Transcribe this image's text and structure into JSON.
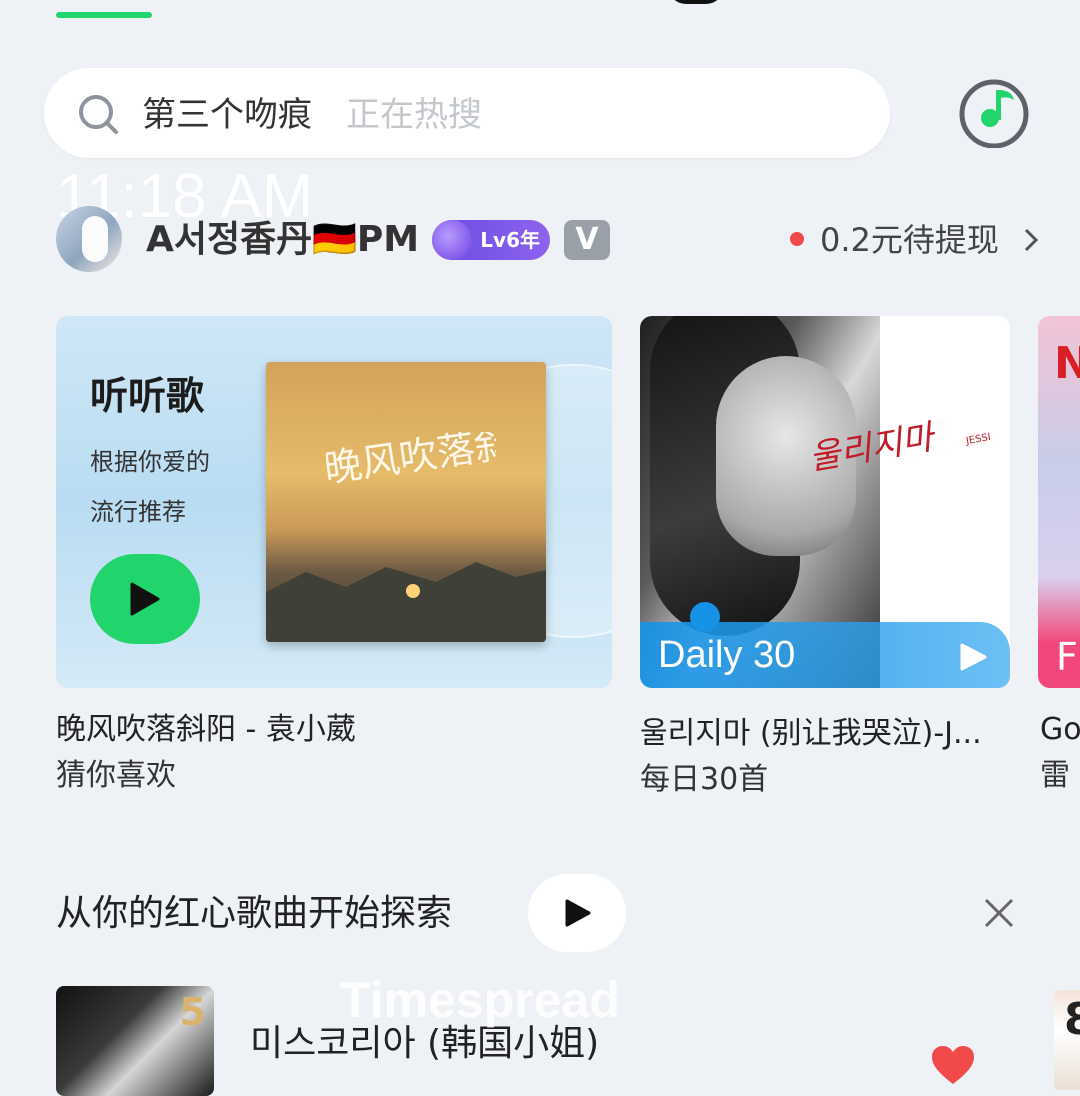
{
  "status": {
    "time": "11:18 AM"
  },
  "search": {
    "term": "第三个吻痕",
    "hint": "正在热搜"
  },
  "profile": {
    "username": "A서정香丹🇩🇪PM",
    "level_badge": "Lv6年",
    "v_badge": "V",
    "cashout": "0.2元待提现"
  },
  "cards": [
    {
      "title": "听听歌",
      "subtitle_line1": "根据你爱的",
      "subtitle_line2": "流行推荐",
      "album_art_text": "晚风吹落斜阳",
      "caption_title": "晚风吹落斜阳 - 袁小葳",
      "caption_sub": "猜你喜欢"
    },
    {
      "overlay_label": "Daily 30",
      "album_script": "울리지마",
      "album_script_small": "JESSI",
      "caption_title": "울리지마 (别让我哭泣)-J...",
      "caption_sub": "每日30首"
    },
    {
      "logo_letter": "N",
      "overlay_letter": "F",
      "caption_title": "Go",
      "caption_sub": "雷"
    }
  ],
  "section": {
    "title": "从你的红心歌曲开始探索"
  },
  "song": {
    "title": "미스코리아 (韩国小姐)",
    "thumb_number": "5",
    "watermark": "Timespread"
  },
  "colors": {
    "accent": "#22d46c",
    "daily_blue": "#1692e6",
    "heart": "#f04a4a"
  }
}
